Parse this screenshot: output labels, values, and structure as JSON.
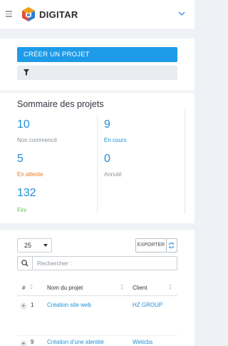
{
  "header": {
    "brand": "DIGITAR",
    "colors": {
      "brand_blue": "#1e9be8",
      "logo_orange": "#f39c12",
      "logo_blue": "#2d7fd3"
    }
  },
  "actions": {
    "create_label": "CRÉER UN PROJET"
  },
  "summary": {
    "title": "Sommaire des projets",
    "stats": [
      {
        "value": "10",
        "label": "Non commencé",
        "color": "#8a939c"
      },
      {
        "value": "9",
        "label": "En cours",
        "color": "#1e8fd6"
      },
      {
        "value": "5",
        "label": "En attente",
        "color": "#f0741f"
      },
      {
        "value": "0",
        "label": "Annulé",
        "color": "#8a939c"
      },
      {
        "value": "132",
        "label": "Fini",
        "color": "#5cb85c"
      }
    ]
  },
  "table_controls": {
    "page_size": "25",
    "export_label": "EXPORTER",
    "search_placeholder": "Rechercher :"
  },
  "table": {
    "columns": [
      "#",
      "Nom du projet",
      "Client"
    ],
    "rows": [
      {
        "id": "1",
        "name": "Création site web",
        "client": "HZ GROUP"
      },
      {
        "id": "9",
        "name": "Création d'une identité",
        "client": "Weticbs"
      }
    ]
  }
}
